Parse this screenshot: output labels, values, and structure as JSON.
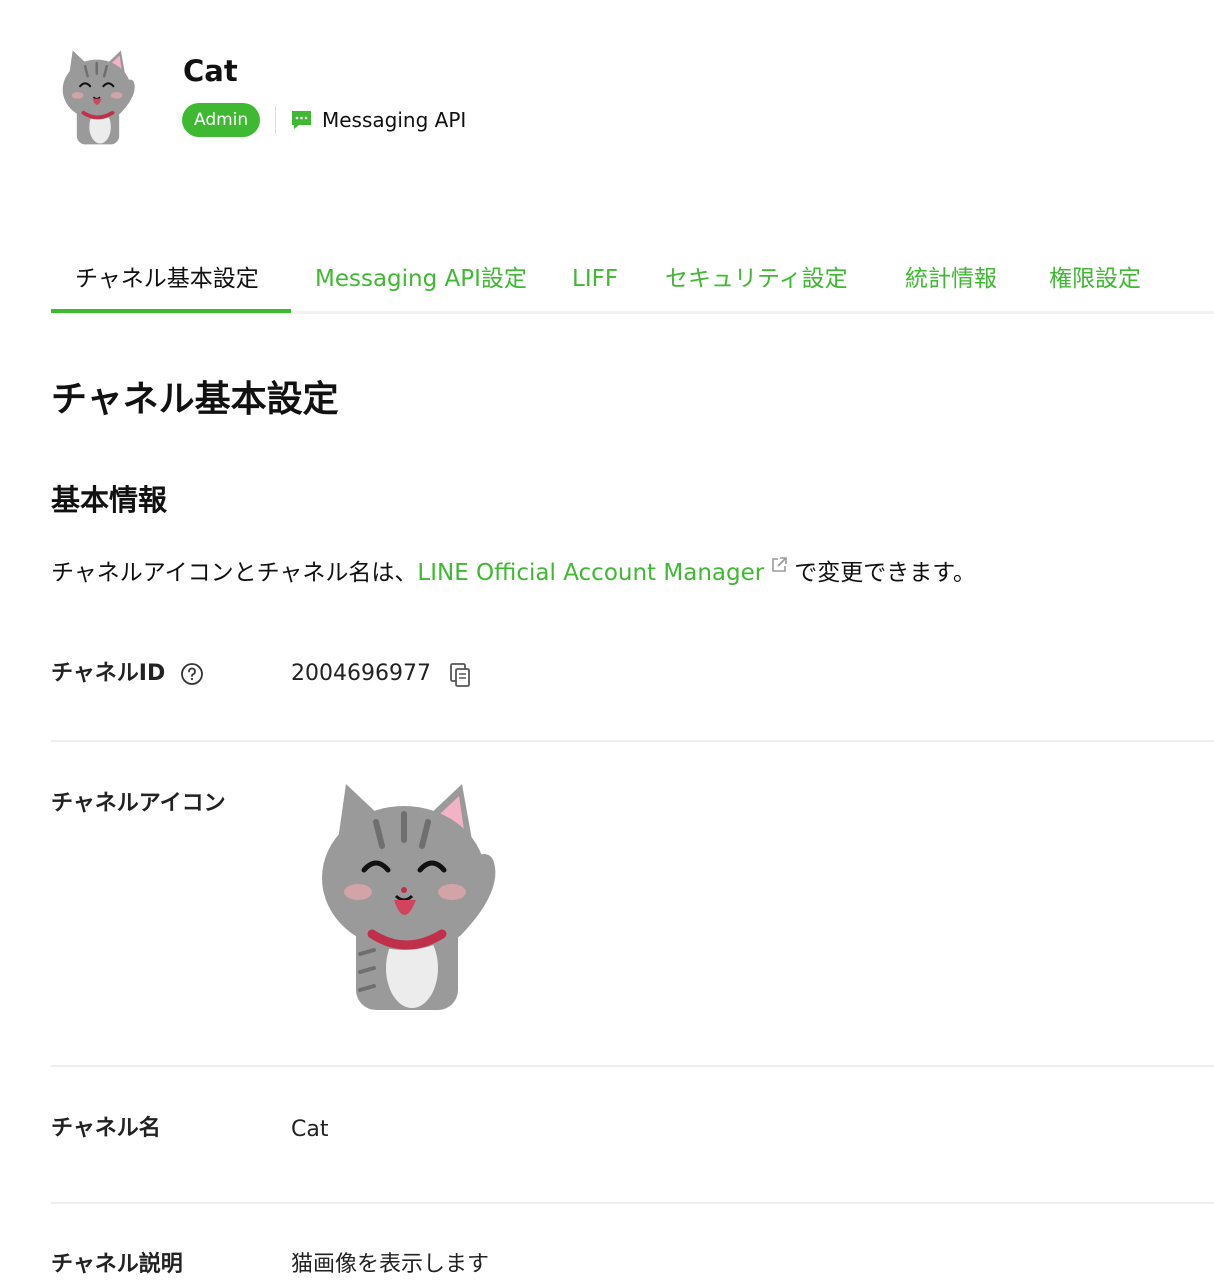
{
  "header": {
    "channel_name": "Cat",
    "role_badge": "Admin",
    "channel_type": "Messaging API",
    "avatar_icon": "cat-avatar-icon",
    "type_icon": "chat-bubble-icon"
  },
  "tabs": [
    {
      "label": "チャネル基本設定",
      "active": true
    },
    {
      "label": "Messaging API設定",
      "active": false
    },
    {
      "label": "LIFF",
      "active": false
    },
    {
      "label": "セキュリティ設定",
      "active": false
    },
    {
      "label": "統計情報",
      "active": false
    },
    {
      "label": "権限設定",
      "active": false
    }
  ],
  "main": {
    "page_title": "チャネル基本設定",
    "section_title": "基本情報",
    "intro_prefix": "チャネルアイコンとチャネル名は、",
    "intro_link": "LINE Official Account Manager",
    "intro_suffix": "で変更できます。"
  },
  "fields": {
    "channel_id": {
      "label": "チャネルID",
      "value": "2004696977"
    },
    "channel_icon": {
      "label": "チャネルアイコン"
    },
    "channel_name": {
      "label": "チャネル名",
      "value": "Cat"
    },
    "channel_description": {
      "label": "チャネル説明",
      "value": "猫画像を表示します"
    }
  },
  "colors": {
    "accent": "#3fb832",
    "text": "#111111",
    "divider": "#eeeeee"
  }
}
